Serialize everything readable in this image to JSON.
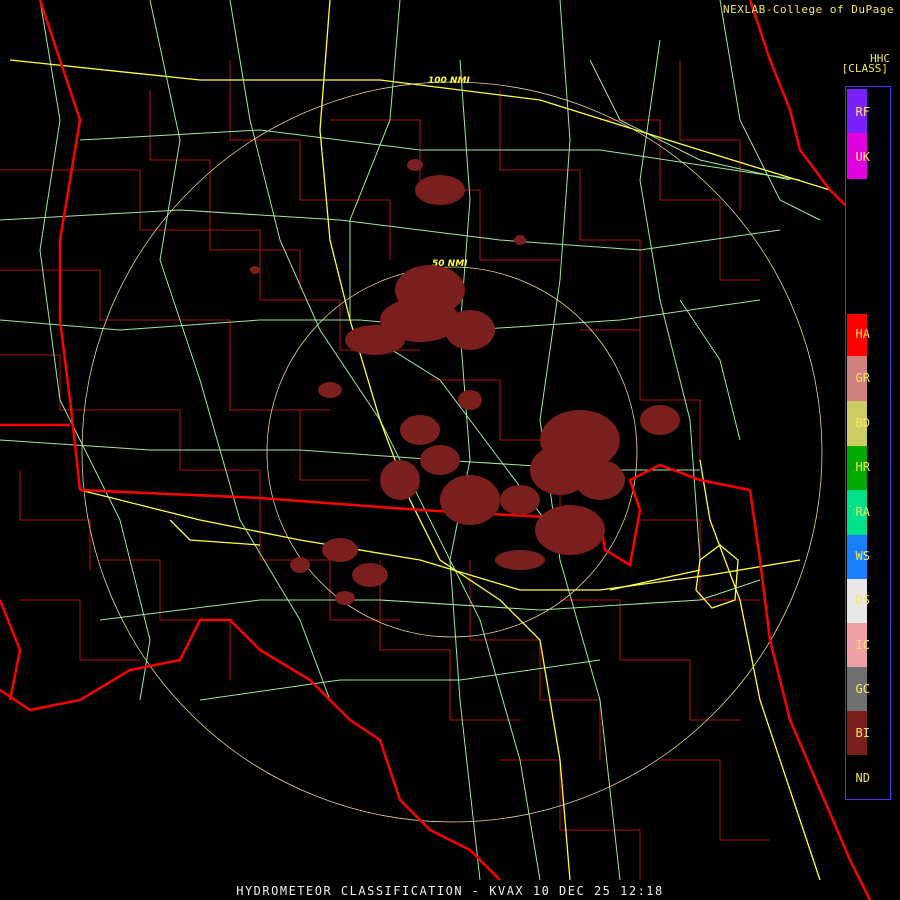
{
  "header": {
    "credit": "NEXLAB-College of DuPage",
    "product_code": "HHC",
    "class_label": "[CLASS]"
  },
  "rings": [
    {
      "label": "100 NMI"
    },
    {
      "label": "50 NMI"
    }
  ],
  "legend": {
    "items": [
      {
        "code": "RF",
        "color": "#7a1fff"
      },
      {
        "code": "UK",
        "color": "#e000e0"
      },
      {
        "code": "HA",
        "color": "#ff0000"
      },
      {
        "code": "GR",
        "color": "#d08080"
      },
      {
        "code": "BD",
        "color": "#cccc66"
      },
      {
        "code": "HR",
        "color": "#00aa00"
      },
      {
        "code": "RA",
        "color": "#00e08a"
      },
      {
        "code": "WS",
        "color": "#1a7fff"
      },
      {
        "code": "DS",
        "color": "#e8e8e8"
      },
      {
        "code": "IC",
        "color": "#f0a0a8"
      },
      {
        "code": "GC",
        "color": "#707070"
      },
      {
        "code": "BI",
        "color": "#7a1e1e"
      },
      {
        "code": "ND",
        "color": "#000000"
      }
    ]
  },
  "footer": {
    "title": "HYDROMETEOR CLASSIFICATION - KVAX 10 DEC 25 12:18"
  },
  "colors": {
    "state_border": "#ff0000",
    "county_line": "#b01010",
    "highway_major": "#ffff40",
    "highway_minor": "#9fe89f",
    "range_ring": "#e8d890",
    "biological_echo": "#7a1e1e"
  }
}
